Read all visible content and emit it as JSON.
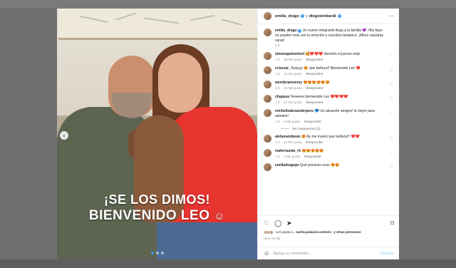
{
  "post": {
    "overlay_line1": "¡SE LOS DIMOS!",
    "overlay_line2": "BIENVENIDO LEO",
    "overlay_emoji": "☺",
    "nav_prev_icon": "‹"
  },
  "header": {
    "user1": "emilia_drago",
    "separator": "y",
    "user2": "diegolombardi",
    "more_icon": "···"
  },
  "caption": {
    "user": "emilia_drago",
    "text": "Un nuevo integrante llega a la familia 💜. Mis hijos no pueden más con la emoción y nosotros tampoco. ¡Miren nuestras caras!",
    "time": "1 d"
  },
  "comments": [
    {
      "user": "ximenapalominof",
      "text": "🥰❤️❤️❤️ devento el jueves exijo",
      "time": "1 d",
      "likes": "38 Me gusta",
      "reply": "Responder"
    },
    {
      "user": "crisesal_",
      "text": "Aaayyy 😍 que belleza!! Bienvenido Leo ❤️",
      "time": "1 d",
      "likes": "14 Me gusta",
      "reply": "Responder"
    },
    {
      "user": "wendyramosrey",
      "text": "😍😍😍😍😍😍",
      "time": "1 d",
      "likes": "24 Me gusta",
      "reply": "Responder"
    },
    {
      "user": "chapasa",
      "text": "Yeeeeee bienvenido Leo ❤️❤️❤️❤️",
      "time": "1 d",
      "likes": "27 Me gusta",
      "reply": "Responder"
    },
    {
      "user": "michellealexanderperu",
      "text": "💙 Un abrazote amigos! lo mejor para ustedes!",
      "time": "1 d",
      "likes": "8 Me gusta",
      "reply": "Responder",
      "view_replies": "Ver respuestas (1)"
    },
    {
      "user": "alebarandiaran",
      "text": "😍 Ay me muero que belleza!!! ❤️❤️",
      "time": "1 d",
      "likes": "11 Me gusta",
      "reply": "Responder"
    },
    {
      "user": "mafernanda_rh",
      "text": "😍😍😍😍😍",
      "time": "1 d",
      "likes": "3 Me gusta",
      "reply": "Responder"
    },
    {
      "user": "emiliadragope",
      "text": "Qué precioso esss 😍😍",
      "time": "",
      "likes": "",
      "reply": ""
    }
  ],
  "likes": {
    "prefix": "Les gusta a",
    "user": "sarita.palacios.selorio",
    "suffix": "y otras personas"
  },
  "post_date": "Hace un día",
  "comment_box": {
    "placeholder": "Agrega un comentario...",
    "publish": "Publicar"
  },
  "icons": {
    "heart": "♡",
    "comment": "◯",
    "share": "➤",
    "save": "⌑",
    "emoji": "☺"
  },
  "colors": {
    "verified": "#3897f0",
    "publish": "#b2dffc"
  }
}
